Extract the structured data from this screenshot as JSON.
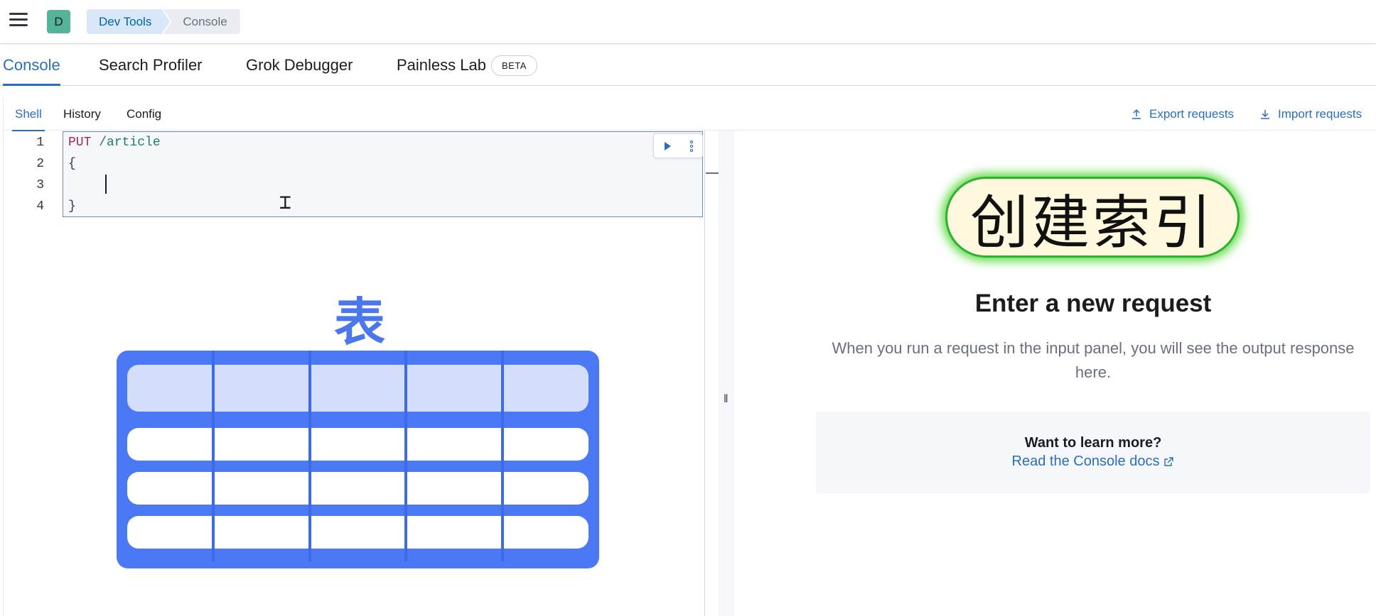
{
  "header": {
    "avatar_initial": "D",
    "breadcrumbs": [
      "Dev Tools",
      "Console"
    ]
  },
  "app_tabs": {
    "console": "Console",
    "search_profiler": "Search Profiler",
    "grok_debugger": "Grok Debugger",
    "painless_lab": "Painless Lab",
    "beta_badge": "BETA"
  },
  "console": {
    "tabs": [
      "Shell",
      "History",
      "Config"
    ],
    "export_label": "Export requests",
    "import_label": "Import requests"
  },
  "editor": {
    "line_numbers": [
      "1",
      "2",
      "3",
      "4"
    ],
    "line1_method": "PUT",
    "line1_path": "/article",
    "line2": "{",
    "line3": "",
    "line4": "}"
  },
  "illustration": {
    "heading": "表",
    "columns": 5,
    "rows": 3
  },
  "output": {
    "badge_text": "创建索引",
    "title": "Enter a new request",
    "body": "When you run a request in the input panel, you will see the output response here.",
    "learn_question": "Want to learn more?",
    "learn_link": "Read the Console docs"
  },
  "colors": {
    "accent": "#2a6fba",
    "badge_glow": "#5fdb46",
    "illustration_blue": "#4b79f5"
  }
}
